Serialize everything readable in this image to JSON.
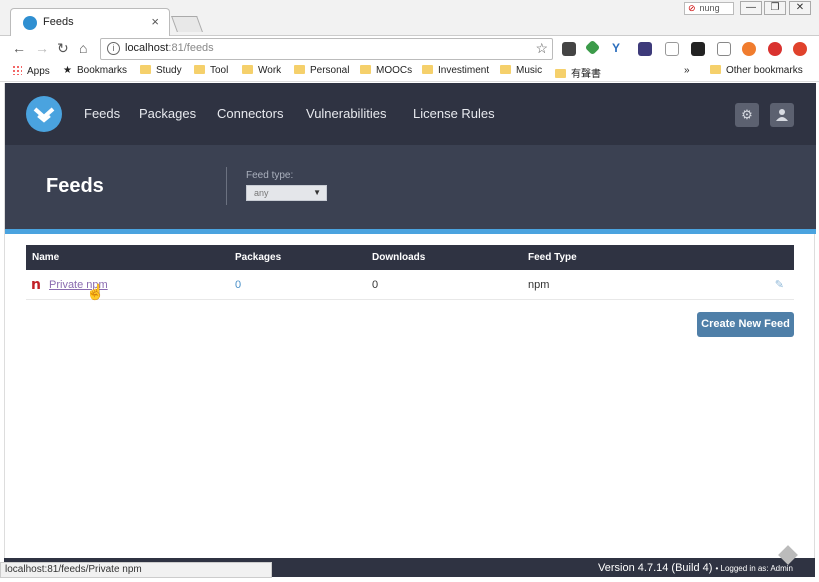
{
  "browser": {
    "tab_title": "Feeds",
    "tab_close": "×",
    "profile_name": "nung",
    "url_host": "localhost",
    "url_path": ":81/feeds",
    "status_url": "localhost:81/feeds/Private npm",
    "window_buttons": [
      "—",
      "❐",
      "✕"
    ]
  },
  "bookmarks": {
    "items": [
      "Apps",
      "Bookmarks",
      "Study",
      "Tool",
      "Work",
      "Personal",
      "MOOCs",
      "Investiment",
      "Music",
      "有聲書"
    ],
    "overflow": "»",
    "other": "Other bookmarks"
  },
  "nav": {
    "links": [
      "Feeds",
      "Packages",
      "Connectors",
      "Vulnerabilities",
      "License Rules"
    ]
  },
  "header": {
    "title": "Feeds",
    "feed_type_label": "Feed type:",
    "feed_type_value": "any"
  },
  "table": {
    "columns": [
      "Name",
      "Packages",
      "Downloads",
      "Feed Type"
    ],
    "rows": [
      {
        "name": "Private npm",
        "packages": "0",
        "downloads": "0",
        "feed_type": "npm"
      }
    ]
  },
  "actions": {
    "create_label": "Create New Feed"
  },
  "footer": {
    "version": "Version 4.7.14 (Build 4)",
    "logged_in": "• Logged in as: Admin"
  },
  "colors": {
    "nav_bg": "#2f3342",
    "header_bg": "#3b4152",
    "accent": "#4aa3df",
    "button": "#4f7fa8"
  }
}
